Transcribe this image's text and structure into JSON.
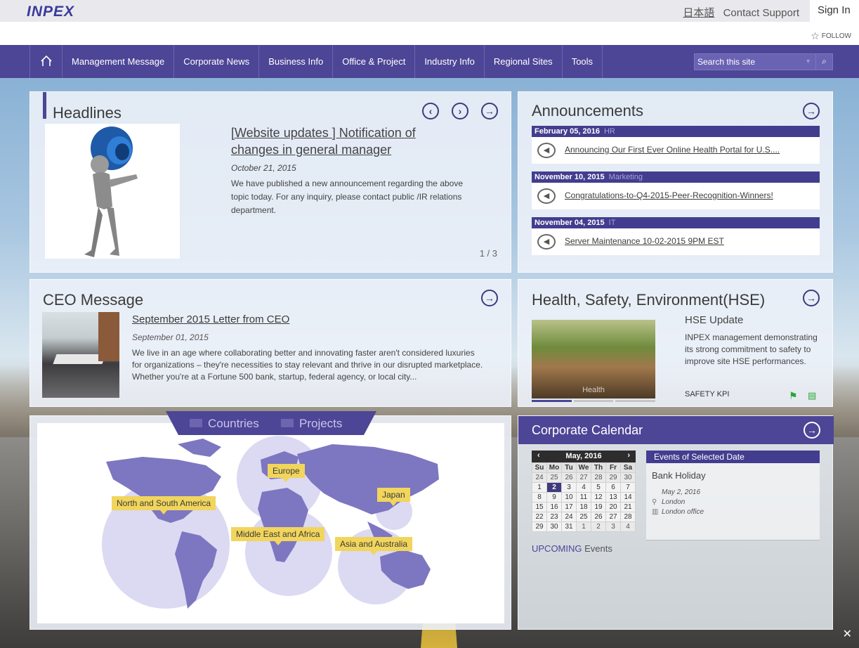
{
  "header": {
    "logo": "INPEX",
    "lang_link": "日本語",
    "contact_link": "Contact Support",
    "signin": "Sign In",
    "follow": "FOLLOW"
  },
  "nav": {
    "items": [
      "Management Message",
      "Corporate News",
      "Business Info",
      "Office & Project",
      "Industry Info",
      "Regional Sites",
      "Tools"
    ],
    "search_placeholder": "Search this site"
  },
  "headlines": {
    "title": "Headlines",
    "item_title": "[Website updates ] Notification of changes in general manager",
    "item_date": "October 21, 2015",
    "item_desc": "We have published a new announcement regarding the above topic today. For any inquiry, please contact public /IR relations department.",
    "pager": "1 / 3"
  },
  "announcements": {
    "title": "Announcements",
    "items": [
      {
        "date": "February 05, 2016",
        "category": "HR",
        "text": "Announcing Our First Ever Online Health Portal for U.S...."
      },
      {
        "date": "November 10, 2015",
        "category": "Marketing",
        "text": "Congratulations-to-Q4-2015-Peer-Recognition-Winners!"
      },
      {
        "date": "November 04, 2015",
        "category": "IT",
        "text": "Server Maintenance 10-02-2015 9PM EST"
      }
    ]
  },
  "ceo": {
    "title": "CEO Message",
    "item_title": "September 2015 Letter from CEO",
    "item_date": "September 01, 2015",
    "item_desc": "We live in an age where collaborating better and innovating faster aren't considered luxuries for organizations – they're necessities to stay relevant and thrive in our disrupted marketplace. Whether you're at a Fortune 500 bank, startup, federal agency, or local city..."
  },
  "hse": {
    "title": "Health, Safety, Environment(HSE)",
    "subtitle": "HSE Update",
    "desc": "INPEX management demonstrating its strong commitment to safety to improve site HSE performances.",
    "image_caption": "Health",
    "kpi_label": "SAFETY KPI"
  },
  "map": {
    "tabs": [
      "Countries",
      "Projects"
    ],
    "labels": [
      "North and South America",
      "Europe",
      "Japan",
      "Middle East and Africa",
      "Asia and Australia"
    ]
  },
  "calendar": {
    "title": "Corporate Calendar",
    "month": "May, 2016",
    "weekdays": [
      "Su",
      "Mo",
      "Tu",
      "We",
      "Th",
      "Fr",
      "Sa"
    ],
    "weeks": [
      [
        "24",
        "25",
        "26",
        "27",
        "28",
        "29",
        "30"
      ],
      [
        "1",
        "2",
        "3",
        "4",
        "5",
        "6",
        "7"
      ],
      [
        "8",
        "9",
        "10",
        "11",
        "12",
        "13",
        "14"
      ],
      [
        "15",
        "16",
        "17",
        "18",
        "19",
        "20",
        "21"
      ],
      [
        "22",
        "23",
        "24",
        "25",
        "26",
        "27",
        "28"
      ],
      [
        "29",
        "30",
        "31",
        "1",
        "2",
        "3",
        "4"
      ]
    ],
    "selected_day": "2",
    "events_header": "Events of Selected Date",
    "event_title": "Bank Holiday",
    "event_date": "May 2, 2016",
    "event_location": "London",
    "event_venue": "London office",
    "upcoming_a": "UPCOMING",
    "upcoming_b": " Events"
  }
}
